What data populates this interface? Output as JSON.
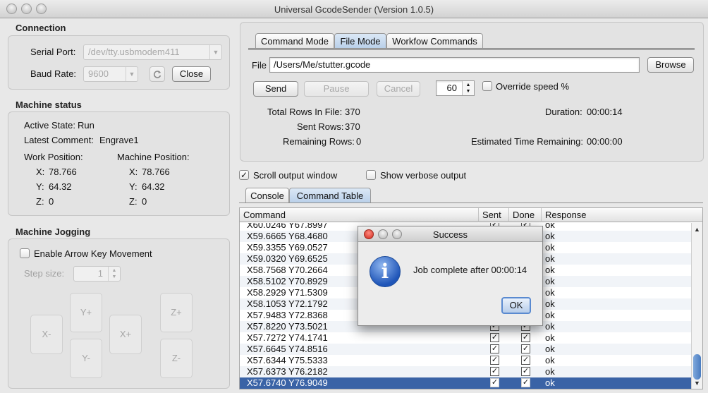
{
  "window": {
    "title": "Universal GcodeSender (Version 1.0.5)"
  },
  "connection": {
    "title": "Connection",
    "serial_port_label": "Serial Port:",
    "serial_port_value": "/dev/tty.usbmodem411",
    "baud_rate_label": "Baud Rate:",
    "baud_rate_value": "9600",
    "close_button": "Close"
  },
  "machine_status": {
    "title": "Machine status",
    "active_state_label": "Active State:",
    "active_state_value": "Run",
    "latest_comment_label": "Latest Comment:",
    "latest_comment_value": "Engrave1",
    "work_position_label": "Work Position:",
    "machine_position_label": "Machine Position:",
    "work": {
      "x_label": "X:",
      "x": "78.766",
      "y_label": "Y:",
      "y": "64.32",
      "z_label": "Z:",
      "z": "0"
    },
    "machine": {
      "x_label": "X:",
      "x": "78.766",
      "y_label": "Y:",
      "y": "64.32",
      "z_label": "Z:",
      "z": "0"
    }
  },
  "jogging": {
    "title": "Machine Jogging",
    "enable_arrow_label": "Enable Arrow Key Movement",
    "step_size_label": "Step size:",
    "step_size_value": "1",
    "buttons": {
      "x_minus": "X-",
      "x_plus": "X+",
      "y_plus": "Y+",
      "y_minus": "Y-",
      "z_plus": "Z+",
      "z_minus": "Z-"
    }
  },
  "tabs": {
    "command_mode": "Command Mode",
    "file_mode": "File Mode",
    "workflow": "Workfow Commands"
  },
  "file_mode": {
    "file_label": "File",
    "file_value": "/Users/Me/stutter.gcode",
    "browse": "Browse",
    "send": "Send",
    "pause": "Pause",
    "cancel": "Cancel",
    "speed_value": "60",
    "override_label": "Override speed %",
    "total_rows_label": "Total Rows In File:",
    "total_rows": "370",
    "sent_rows_label": "Sent Rows:",
    "sent_rows": "370",
    "remaining_rows_label": "Remaining Rows:",
    "remaining_rows": "0",
    "duration_label": "Duration:",
    "duration": "00:00:14",
    "remaining_time_label": "Estimated Time Remaining:",
    "remaining_time": "00:00:00"
  },
  "options": {
    "scroll_output": "Scroll output window",
    "verbose_output": "Show verbose output"
  },
  "output_tabs": {
    "console": "Console",
    "command_table": "Command Table"
  },
  "table": {
    "headers": [
      "Command",
      "Sent",
      "Done",
      "Response"
    ],
    "rows": [
      [
        "X60.0246 Y67.8997",
        true,
        true,
        "ok"
      ],
      [
        "X59.6665 Y68.4680",
        true,
        true,
        "ok"
      ],
      [
        "X59.3355 Y69.0527",
        true,
        true,
        "ok"
      ],
      [
        "X59.0320 Y69.6525",
        true,
        true,
        "ok"
      ],
      [
        "X58.7568 Y70.2664",
        true,
        true,
        "ok"
      ],
      [
        "X58.5102 Y70.8929",
        true,
        true,
        "ok"
      ],
      [
        "X58.2929 Y71.5309",
        true,
        true,
        "ok"
      ],
      [
        "X58.1053 Y72.1792",
        true,
        true,
        "ok"
      ],
      [
        "X57.9483 Y72.8368",
        true,
        true,
        "ok"
      ],
      [
        "X57.8220 Y73.5021",
        true,
        true,
        "ok"
      ],
      [
        "X57.7272 Y74.1741",
        true,
        true,
        "ok"
      ],
      [
        "X57.6645 Y74.8516",
        true,
        true,
        "ok"
      ],
      [
        "X57.6344 Y75.5333",
        true,
        true,
        "ok"
      ],
      [
        "X57.6373 Y76.2182",
        true,
        true,
        "ok"
      ],
      [
        "X57.6740 Y76.9049",
        true,
        true,
        "ok"
      ]
    ],
    "selected_row": 14
  },
  "dialog": {
    "title": "Success",
    "message": "Job complete after 00:00:14",
    "ok": "OK",
    "icon": "info-icon"
  },
  "colors": {
    "selection": "#3a63a6",
    "accent": "#1f55b8",
    "close_light": "#d0291c"
  }
}
